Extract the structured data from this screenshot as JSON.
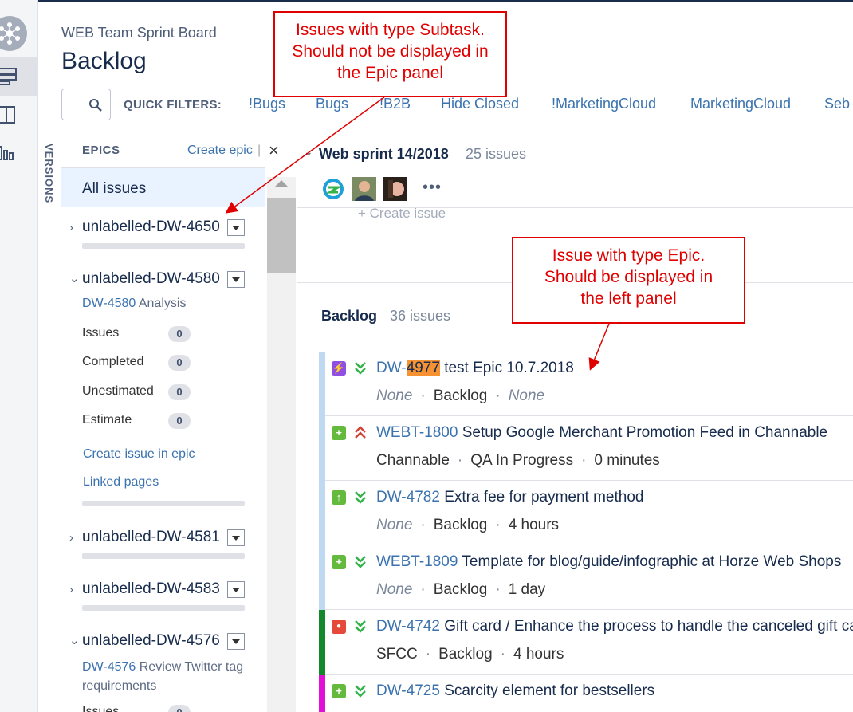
{
  "header": {
    "board_name": "WEB Team Sprint Board",
    "page_title": "Backlog",
    "quick_filters_label": "QUICK FILTERS:",
    "quick_filters": [
      "!Bugs",
      "Bugs",
      "!B2B",
      "Hide Closed",
      "!MarketingCloud",
      "MarketingCloud",
      "Seb"
    ]
  },
  "versions_tab": "VERSIONS",
  "epics_panel": {
    "title": "EPICS",
    "create_epic": "Create epic",
    "separator": "|",
    "close": "×",
    "all_issues": "All issues",
    "epics": [
      {
        "name": "unlabelled-DW-4650",
        "chevron": "›"
      },
      {
        "name": "unlabelled-DW-4580",
        "chevron": "⌄",
        "key": "DW-4580",
        "summary": "Analysis",
        "stats": [
          {
            "label": "Issues",
            "value": "0"
          },
          {
            "label": "Completed",
            "value": "0"
          },
          {
            "label": "Unestimated",
            "value": "0"
          },
          {
            "label": "Estimate",
            "value": "0"
          }
        ],
        "links": [
          "Create issue in epic",
          "Linked pages"
        ]
      },
      {
        "name": "unlabelled-DW-4581",
        "chevron": "›"
      },
      {
        "name": "unlabelled-DW-4583",
        "chevron": "›"
      },
      {
        "name": "unlabelled-DW-4576",
        "chevron": "⌄",
        "key": "DW-4576",
        "summary": "Review Twitter tag requirements",
        "next_stat": "Issues",
        "next_value": "0"
      }
    ]
  },
  "sprint": {
    "name": "Web sprint 14/2018",
    "count": "25 issues",
    "more": "•••",
    "create_issue": "+   Create issue"
  },
  "backlog": {
    "name": "Backlog",
    "count": "36 issues",
    "issues": [
      {
        "key_prefix": "DW-",
        "key_highlight": "4977",
        "summary": "test Epic 10.7.2018",
        "meta": [
          "None",
          "Backlog",
          "None"
        ],
        "type": "epic",
        "type_glyph": "⚡",
        "priority": "low",
        "stripe": "#c0d9f2"
      },
      {
        "key": "WEBT-1800",
        "summary": "Setup Google Merchant Promotion Feed in Channable",
        "meta": [
          "Channable",
          "QA In Progress",
          "0 minutes"
        ],
        "type": "story",
        "type_glyph": "+",
        "priority": "high",
        "stripe": "#c0d9f2"
      },
      {
        "key": "DW-4782",
        "summary": "Extra fee for payment method",
        "meta": [
          "None",
          "Backlog",
          "4 hours"
        ],
        "type": "improvement",
        "type_glyph": "↑",
        "priority": "low",
        "stripe": "#c0d9f2"
      },
      {
        "key": "WEBT-1809",
        "summary": "Template for blog/guide/infographic at Horze Web Shops",
        "meta": [
          "None",
          "Backlog",
          "1 day"
        ],
        "type": "story",
        "type_glyph": "+",
        "priority": "low",
        "stripe": "#c0d9f2"
      },
      {
        "key": "DW-4742",
        "summary": "Gift card / Enhance the process to handle the canceled gift ca",
        "meta": [
          "SFCC",
          "Backlog",
          "4 hours"
        ],
        "type": "bug",
        "type_glyph": "●",
        "priority": "low",
        "stripe": "#14892c"
      },
      {
        "key": "DW-4725",
        "summary": "Scarcity element for bestsellers",
        "meta": [],
        "type": "story",
        "type_glyph": "+",
        "priority": "low",
        "stripe": "#e20fd6"
      }
    ]
  },
  "callouts": {
    "subtask": "Issues with type Subtask. Should not be displayed in the Epic panel",
    "epic": "Issue with type Epic. Should be displayed in the left panel"
  },
  "colors": {
    "link": "#3b73af",
    "epic_type": "#904ee2",
    "story_type": "#63ba3c",
    "bug_type": "#e5493a",
    "highlight": "#f79232",
    "callout": "#e00000"
  }
}
